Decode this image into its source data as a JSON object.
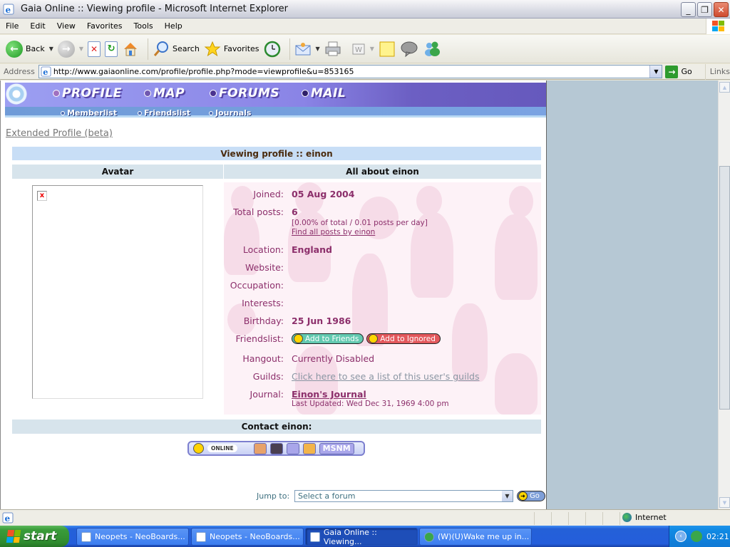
{
  "window": {
    "title": "Gaia Online :: Viewing profile - Microsoft Internet Explorer",
    "buttons": {
      "minimize": "_",
      "restore": "❐",
      "close": "✕"
    }
  },
  "menubar": {
    "items": [
      "File",
      "Edit",
      "View",
      "Favorites",
      "Tools",
      "Help"
    ]
  },
  "toolbar": {
    "back_label": "Back",
    "search_label": "Search",
    "favorites_label": "Favorites"
  },
  "address": {
    "label": "Address",
    "url": "http://www.gaiaonline.com/profile/profile.php?mode=viewprofile&u=853165",
    "go_label": "Go",
    "links_label": "Links"
  },
  "gaia_nav": {
    "main": [
      {
        "label": "PROFILE",
        "dot_color": "#a070c0"
      },
      {
        "label": "MAP",
        "dot_color": "#7058b0"
      },
      {
        "label": "FORUMS",
        "dot_color": "#4a3290"
      },
      {
        "label": "MAIL",
        "dot_color": "#2e1f6a"
      }
    ],
    "sub": [
      "Memberlist",
      "Friendslist",
      "Journals"
    ]
  },
  "profile": {
    "extended_link": "Extended Profile (beta)",
    "header": "Viewing profile :: einon",
    "avatar_header": "Avatar",
    "about_header": "All about einon",
    "broken_image_glyph": "x",
    "fields": {
      "joined": {
        "label": "Joined:",
        "value": "05 Aug 2004"
      },
      "total_posts": {
        "label": "Total posts:",
        "value": "6",
        "stats": "[0.00% of total / 0.01 posts per day]",
        "find_link": "Find all posts by einon"
      },
      "location": {
        "label": "Location:",
        "value": "England"
      },
      "website": {
        "label": "Website:",
        "value": ""
      },
      "occupation": {
        "label": "Occupation:",
        "value": ""
      },
      "interests": {
        "label": "Interests:",
        "value": ""
      },
      "birthday": {
        "label": "Birthday:",
        "value": "25 Jun 1986"
      },
      "friendslist": {
        "label": "Friendslist:",
        "add_friends": "Add to Friends",
        "add_ignored": "Add to Ignored"
      },
      "hangout": {
        "label": "Hangout:",
        "value": "Currently Disabled"
      },
      "guilds": {
        "label": "Guilds:",
        "value": "Click here to see a list of this user's guilds"
      },
      "journal": {
        "label": "Journal:",
        "value": "Einon's Journal",
        "updated": "Last Updated: Wed Dec 31, 1969 4:00 pm"
      }
    },
    "contact_header": "Contact einon:",
    "contact_bar": {
      "status": "ONLINE",
      "msnm": "MSNM"
    }
  },
  "jump": {
    "label": "Jump to:",
    "selected": "Select a forum",
    "go": "Go"
  },
  "statusbar": {
    "zone": "Internet"
  },
  "taskbar": {
    "start": "start",
    "tasks": [
      {
        "label": "Neopets - NeoBoards...",
        "active": false
      },
      {
        "label": "Neopets - NeoBoards...",
        "active": false
      },
      {
        "label": "Gaia Online :: Viewing...",
        "active": true
      },
      {
        "label": "(W)(U)Wake me up in...",
        "active": false
      }
    ],
    "clock": "02:21"
  },
  "colors": {
    "profile_text": "#8c2f6b",
    "header_blue": "#c8def6",
    "subheader": "#d7e4ec",
    "nav_purple": "#8a84e6"
  }
}
